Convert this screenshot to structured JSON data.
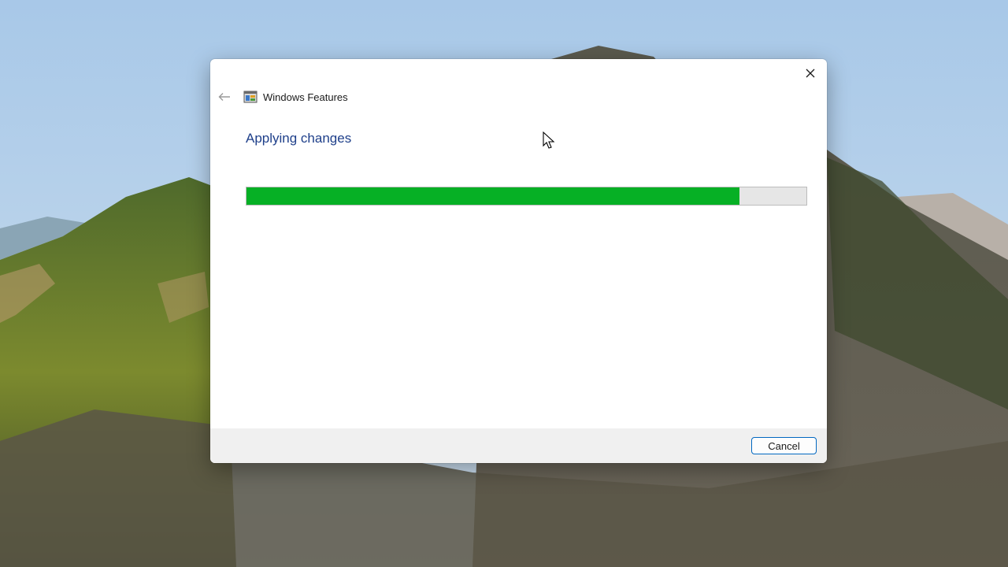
{
  "window": {
    "title": "Windows Features",
    "heading": "Applying changes",
    "progress_percent": 88,
    "cancel_label": "Cancel"
  },
  "colors": {
    "progress_fill": "#06b025",
    "heading_text": "#1e3f8a",
    "button_border": "#0067c0"
  },
  "icons": {
    "back": "arrow-left-icon",
    "app": "windows-features-icon",
    "close": "close-icon",
    "cursor": "mouse-pointer-icon"
  }
}
